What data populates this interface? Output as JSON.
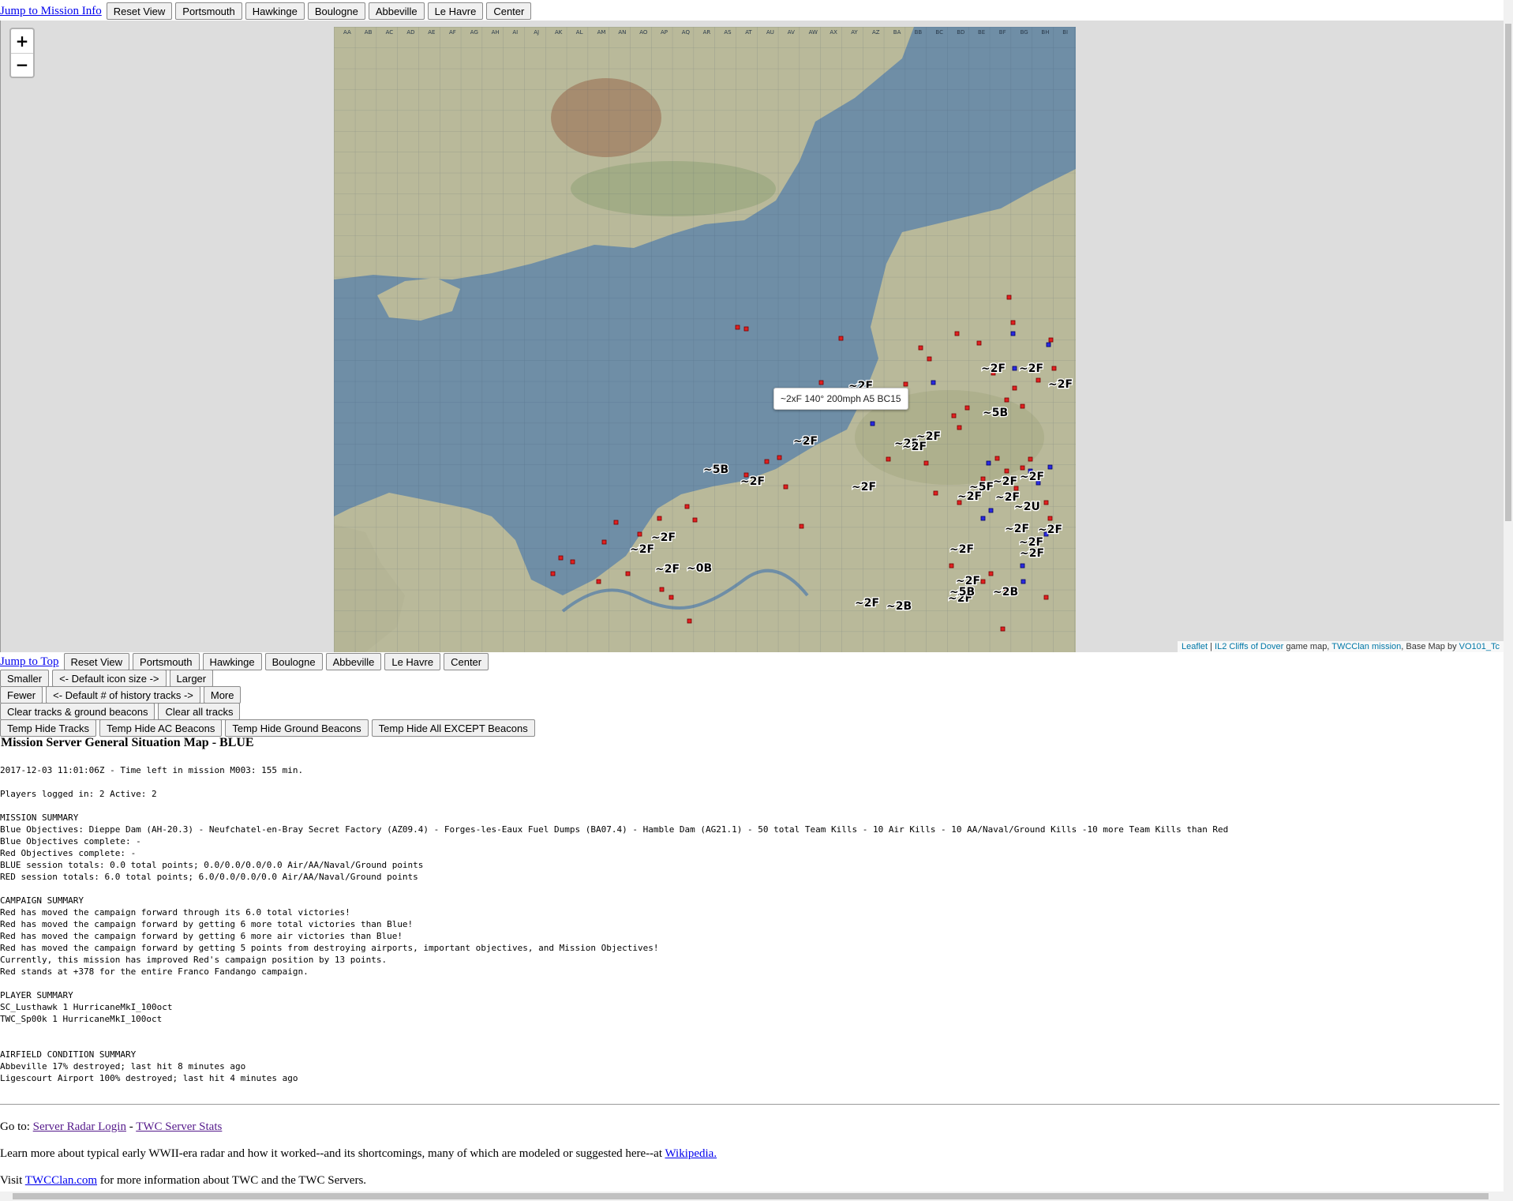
{
  "toolbar_top": {
    "jump_link": "Jump to Mission Info",
    "buttons": [
      "Reset View",
      "Portsmouth",
      "Hawkinge",
      "Boulogne",
      "Abbeville",
      "Le Havre",
      "Center"
    ]
  },
  "map": {
    "zoom_in": "+",
    "zoom_out": "−",
    "tooltip": "~2xF 140° 200mph A5 BC15",
    "grid_top_labels": [
      "AA",
      "AB",
      "AC",
      "AD",
      "AE",
      "AF",
      "AG",
      "AH",
      "AI",
      "AJ",
      "AK",
      "AL",
      "AM",
      "AN",
      "AO",
      "AP",
      "AQ",
      "AR",
      "AS",
      "AT",
      "AU",
      "AV",
      "AW",
      "AX",
      "AY",
      "AZ",
      "BA",
      "BB",
      "BC",
      "BD",
      "BE",
      "BF",
      "BG",
      "BH",
      "BI"
    ],
    "contacts": [
      "~2F",
      "~2F",
      "~2F",
      "~2F",
      "~5B",
      "~2F",
      "~2F",
      "~2F",
      "~2F",
      "~5B",
      "~2F",
      "~2F",
      "~2F",
      "~2F",
      "~2F",
      "~5F",
      "~2F",
      "~2U",
      "~2F",
      "~2F",
      "~2F",
      "~2F",
      "~2F",
      "~2F",
      "~2F",
      "~2F",
      "~2F",
      "~2F",
      "~0B",
      "~2F",
      "~5B",
      "~2B",
      "~2B"
    ],
    "attribution": {
      "leaflet": "Leaflet",
      "sep": " | ",
      "il2": "IL2 Cliffs of Dover",
      "game_map": " game map, ",
      "twc": "TWCClan mission",
      "base": ", Base Map by ",
      "vo": "VO101_Tc"
    },
    "colors": {
      "sea": "#6e8ca4",
      "land": "#b8b89a",
      "red_marker": "#e02020",
      "blue_marker": "#2a2ae0"
    }
  },
  "toolbar_bottom": {
    "jump_link": "Jump to Top",
    "buttons": [
      "Reset View",
      "Portsmouth",
      "Hawkinge",
      "Boulogne",
      "Abbeville",
      "Le Havre",
      "Center"
    ]
  },
  "controls": {
    "smaller": "Smaller",
    "default_icon": "<- Default icon size ->",
    "larger": "Larger",
    "fewer": "Fewer",
    "default_tracks": "<- Default # of history tracks ->",
    "more": "More",
    "clear_tracks_beacons": "Clear tracks & ground beacons",
    "clear_all": "Clear all tracks",
    "hide_tracks": "Temp Hide Tracks",
    "hide_ac": "Temp Hide AC Beacons",
    "hide_ground": "Temp Hide Ground Beacons",
    "hide_all_except": "Temp Hide All EXCEPT Beacons"
  },
  "info": {
    "title": "Mission Server General Situation Map - BLUE",
    "lines": [
      "2017-12-03 11:01:06Z - Time left in mission M003: 155 min.",
      "",
      "Players logged in: 2 Active: 2",
      "",
      "MISSION SUMMARY",
      "Blue Objectives: Dieppe Dam (AH-20.3) - Neufchatel-en-Bray Secret Factory (AZ09.4) - Forges-les-Eaux Fuel Dumps (BA07.4) - Hamble Dam (AG21.1) - 50 total Team Kills - 10 Air Kills - 10 AA/Naval/Ground Kills -10 more Team Kills than Red",
      "Blue Objectives complete: -",
      "Red Objectives complete: -",
      "BLUE session totals: 0.0 total points; 0.0/0.0/0.0/0.0 Air/AA/Naval/Ground points",
      "RED session totals: 6.0 total points; 6.0/0.0/0.0/0.0 Air/AA/Naval/Ground points",
      "",
      "CAMPAIGN SUMMARY",
      "Red has moved the campaign forward through its 6.0 total victories!",
      "Red has moved the campaign forward by getting 6 more total victories than Blue!",
      "Red has moved the campaign forward by getting 6 more air victories than Blue!",
      "Red has moved the campaign forward by getting 5 points from destroying airports, important objectives, and Mission Objectives!",
      "Currently, this mission has improved Red's campaign position by 13 points.",
      "Red stands at +378 for the entire Franco Fandango campaign.",
      "",
      "PLAYER SUMMARY",
      "SC_Lusthawk 1 HurricaneMkI_100oct",
      "TWC_Sp00k 1 HurricaneMkI_100oct",
      "",
      "",
      "AIRFIELD CONDITION SUMMARY",
      "Abbeville 17% destroyed; last hit 8 minutes ago",
      "Ligescourt Airport 100% destroyed; last hit 4 minutes ago"
    ]
  },
  "footer": {
    "goto_prefix": "Go to: ",
    "server_radar": "Server Radar Login",
    "dash": " - ",
    "twc_stats": "TWC Server Stats",
    "learn_prefix": "Learn more about typical early WWII-era radar and how it worked--and its shortcomings, many of which are modeled or suggested here--at ",
    "wikipedia": "Wikipedia.",
    "visit_prefix": "Visit ",
    "twcclan": "TWCClan.com",
    "visit_suffix": " for more information about TWC and the TWC Servers."
  }
}
